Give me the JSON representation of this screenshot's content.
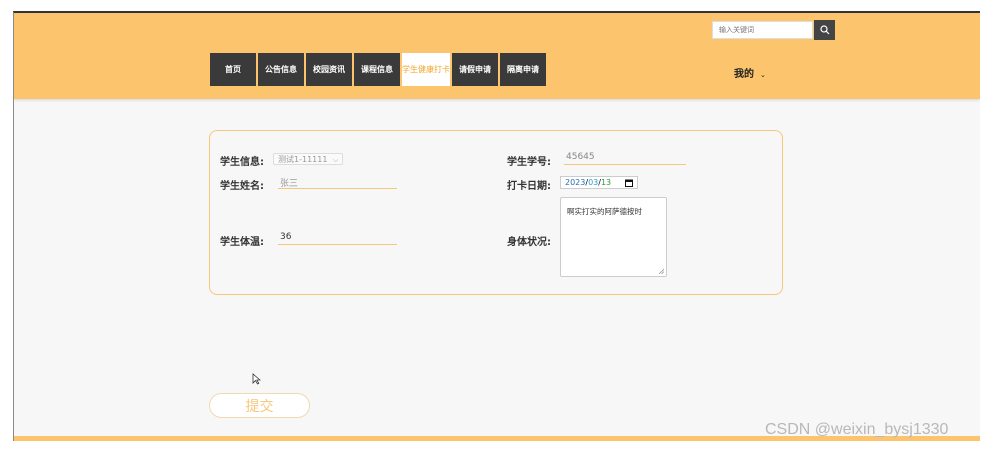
{
  "header": {
    "search": {
      "placeholder": "输入关键词"
    },
    "nav": [
      {
        "label": "首页"
      },
      {
        "label": "公告信息"
      },
      {
        "label": "校园资讯"
      },
      {
        "label": "课程信息"
      },
      {
        "label": "学生健康打卡",
        "active": true
      },
      {
        "label": "请假申请"
      },
      {
        "label": "隔离申请"
      }
    ],
    "user_menu": {
      "label": "我的",
      "caret": "⌄"
    }
  },
  "form": {
    "student_info": {
      "label": "学生信息:",
      "value": "测试1-11111"
    },
    "student_no": {
      "label": "学生学号:",
      "value": "45645"
    },
    "student_name": {
      "label": "学生姓名:",
      "value": "张三"
    },
    "checkin_date": {
      "label": "打卡日期:",
      "year": "2023",
      "month": "03",
      "day": "13",
      "sep": "/"
    },
    "temperature": {
      "label": "学生体温:",
      "value": "36"
    },
    "health": {
      "label": "身体状况:",
      "value": "啊实打实的阿萨德按时"
    }
  },
  "submit_label": "提交",
  "watermark": "CSDN @weixin_bysj1330",
  "colors": {
    "accent": "#fcc56d",
    "nav_bg": "#3a3a3a",
    "active_text": "#f0a830",
    "border": "#f5c77e"
  }
}
